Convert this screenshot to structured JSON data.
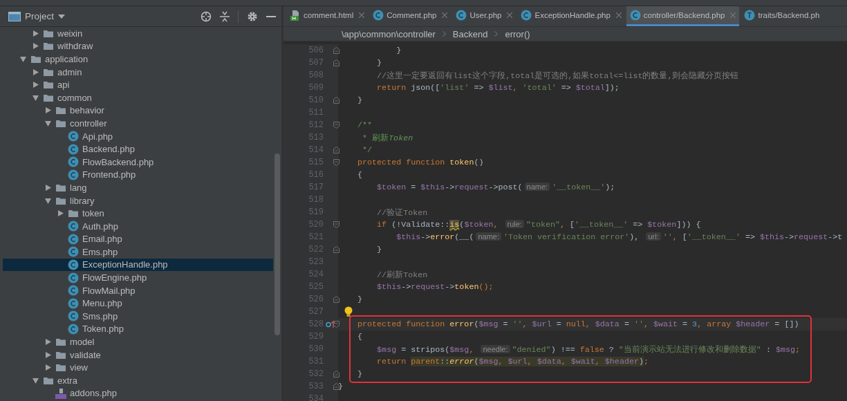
{
  "sidebar": {
    "title": "Project",
    "tree": {
      "cut_parent_children": [
        {
          "label": "weixin",
          "kind": "folder",
          "expanded": false,
          "selected": false
        },
        {
          "label": "withdraw",
          "kind": "folder",
          "expanded": false,
          "selected": false
        }
      ],
      "items": [
        {
          "label": "application",
          "kind": "folder",
          "expanded": true,
          "selected": false,
          "children": [
            {
              "label": "admin",
              "kind": "folder",
              "expanded": false,
              "selected": false
            },
            {
              "label": "api",
              "kind": "folder",
              "expanded": false,
              "selected": false
            },
            {
              "label": "common",
              "kind": "folder",
              "expanded": true,
              "selected": false,
              "children": [
                {
                  "label": "behavior",
                  "kind": "folder",
                  "expanded": false,
                  "selected": false
                },
                {
                  "label": "controller",
                  "kind": "folder",
                  "expanded": true,
                  "selected": false,
                  "children": [
                    {
                      "label": "Api.php",
                      "kind": "class",
                      "selected": false
                    },
                    {
                      "label": "Backend.php",
                      "kind": "class",
                      "selected": false
                    },
                    {
                      "label": "FlowBackend.php",
                      "kind": "class",
                      "selected": false
                    },
                    {
                      "label": "Frontend.php",
                      "kind": "class",
                      "selected": false
                    }
                  ]
                },
                {
                  "label": "lang",
                  "kind": "folder",
                  "expanded": false,
                  "selected": false
                },
                {
                  "label": "library",
                  "kind": "folder",
                  "expanded": true,
                  "selected": false,
                  "children": [
                    {
                      "label": "token",
                      "kind": "folder",
                      "expanded": false,
                      "selected": false
                    },
                    {
                      "label": "Auth.php",
                      "kind": "class",
                      "selected": false
                    },
                    {
                      "label": "Email.php",
                      "kind": "class",
                      "selected": false
                    },
                    {
                      "label": "Ems.php",
                      "kind": "class",
                      "selected": false
                    },
                    {
                      "label": "ExceptionHandle.php",
                      "kind": "class",
                      "selected": true
                    },
                    {
                      "label": "FlowEngine.php",
                      "kind": "class",
                      "selected": false
                    },
                    {
                      "label": "FlowMail.php",
                      "kind": "class",
                      "selected": false
                    },
                    {
                      "label": "Menu.php",
                      "kind": "class",
                      "selected": false
                    },
                    {
                      "label": "Sms.php",
                      "kind": "class",
                      "selected": false
                    },
                    {
                      "label": "Token.php",
                      "kind": "class",
                      "selected": false
                    }
                  ]
                },
                {
                  "label": "model",
                  "kind": "folder",
                  "expanded": false,
                  "selected": false
                },
                {
                  "label": "validate",
                  "kind": "folder",
                  "expanded": false,
                  "selected": false
                },
                {
                  "label": "view",
                  "kind": "folder",
                  "expanded": false,
                  "selected": false
                }
              ]
            },
            {
              "label": "extra",
              "kind": "folder",
              "expanded": true,
              "selected": false,
              "children": [
                {
                  "label": "addons.php",
                  "kind": "php",
                  "selected": false
                }
              ]
            }
          ]
        }
      ]
    }
  },
  "tabs": [
    {
      "label": "comment.html",
      "kind": "html",
      "selected": false,
      "closable": true
    },
    {
      "label": "Comment.php",
      "kind": "class",
      "selected": false,
      "closable": true
    },
    {
      "label": "User.php",
      "kind": "class",
      "selected": false,
      "closable": true
    },
    {
      "label": "ExceptionHandle.php",
      "kind": "class",
      "selected": false,
      "closable": true
    },
    {
      "label": "controller/Backend.php",
      "kind": "class",
      "selected": true,
      "closable": true
    },
    {
      "label": "traits/Backend.ph",
      "kind": "trait",
      "selected": false,
      "closable": false
    }
  ],
  "breadcrumb": [
    "\\app\\common\\controller",
    "Backend",
    "error()"
  ],
  "editor": {
    "lines": [
      {
        "number": "506",
        "fold_close": true,
        "tokens": [
          {
            "kind": "plain",
            "text": "            }"
          }
        ]
      },
      {
        "number": "507",
        "fold_close": true,
        "tokens": [
          {
            "kind": "plain",
            "text": "        }"
          }
        ]
      },
      {
        "number": "508",
        "tokens": [
          {
            "kind": "comment",
            "text": "        //这里一定要返回有list这个字段,total是可选的,如果total<=list的数量,则会隐藏分页按钮"
          }
        ]
      },
      {
        "number": "509",
        "tokens": [
          {
            "kind": "keyword",
            "text": "        return"
          },
          {
            "kind": "plain",
            "text": " json(["
          },
          {
            "kind": "string",
            "text": "'list'"
          },
          {
            "kind": "plain",
            "text": " => "
          },
          {
            "kind": "variable",
            "text": "$list"
          },
          {
            "kind": "keyword",
            "text": ", "
          },
          {
            "kind": "string",
            "text": "'total'"
          },
          {
            "kind": "plain",
            "text": " => "
          },
          {
            "kind": "variable",
            "text": "$total"
          },
          {
            "kind": "plain",
            "text": "]);"
          }
        ]
      },
      {
        "number": "510",
        "fold_close": true,
        "tokens": [
          {
            "kind": "plain",
            "text": "    }"
          }
        ]
      },
      {
        "number": "511"
      },
      {
        "number": "512",
        "fold_open": true,
        "tokens": [
          {
            "kind": "doc",
            "text": "    /**"
          }
        ]
      },
      {
        "number": "513",
        "tokens": [
          {
            "kind": "doc",
            "text": "     * 刷新"
          },
          {
            "kind": "doc_italic",
            "text": "Token"
          }
        ]
      },
      {
        "number": "514",
        "fold_close": true,
        "tokens": [
          {
            "kind": "doc",
            "text": "     */"
          }
        ]
      },
      {
        "number": "515",
        "fold_open": true,
        "tokens": [
          {
            "kind": "keyword",
            "text": "    protected function "
          },
          {
            "kind": "function",
            "text": "token"
          },
          {
            "kind": "plain",
            "text": "()"
          }
        ]
      },
      {
        "number": "516",
        "tokens": [
          {
            "kind": "plain",
            "text": "    {"
          }
        ]
      },
      {
        "number": "517",
        "tokens": [
          {
            "kind": "variable",
            "text": "        $token"
          },
          {
            "kind": "plain",
            "text": " = "
          },
          {
            "kind": "variable",
            "text": "$this"
          },
          {
            "kind": "plain",
            "text": "->"
          },
          {
            "kind": "field",
            "text": "request"
          },
          {
            "kind": "plain",
            "text": "->post("
          },
          {
            "kind": "hint",
            "text": "name:"
          },
          {
            "kind": "string",
            "text": "'__token__'"
          },
          {
            "kind": "plain",
            "text": ");"
          }
        ]
      },
      {
        "number": "518"
      },
      {
        "number": "519",
        "tokens": [
          {
            "kind": "comment",
            "text": "        //验证Token"
          }
        ]
      },
      {
        "number": "520",
        "fold_open": true,
        "tokens": [
          {
            "kind": "keyword",
            "text": "        if"
          },
          {
            "kind": "plain",
            "text": " (!Validate::"
          },
          {
            "kind": "warning",
            "text": "is"
          },
          {
            "kind": "plain",
            "text": "("
          },
          {
            "kind": "variable",
            "text": "$token"
          },
          {
            "kind": "keyword",
            "text": ", "
          },
          {
            "kind": "hint",
            "text": "rule:"
          },
          {
            "kind": "string",
            "text": "\"token\""
          },
          {
            "kind": "keyword",
            "text": ", "
          },
          {
            "kind": "plain",
            "text": "["
          },
          {
            "kind": "string",
            "text": "'__token__'"
          },
          {
            "kind": "plain",
            "text": " => "
          },
          {
            "kind": "variable",
            "text": "$token"
          },
          {
            "kind": "plain",
            "text": "])) {"
          }
        ]
      },
      {
        "number": "521",
        "tokens": [
          {
            "kind": "variable",
            "text": "            $this"
          },
          {
            "kind": "plain",
            "text": "->"
          },
          {
            "kind": "call",
            "text": "error"
          },
          {
            "kind": "plain",
            "text": "(__("
          },
          {
            "kind": "hint",
            "text": "name:"
          },
          {
            "kind": "string",
            "text": "'Token verification error'"
          },
          {
            "kind": "plain",
            "text": "), "
          },
          {
            "kind": "hint",
            "text": "url:"
          },
          {
            "kind": "string",
            "text": "''"
          },
          {
            "kind": "keyword",
            "text": ", "
          },
          {
            "kind": "plain",
            "text": "["
          },
          {
            "kind": "string",
            "text": "'__token__'"
          },
          {
            "kind": "plain",
            "text": " => "
          },
          {
            "kind": "variable",
            "text": "$this"
          },
          {
            "kind": "plain",
            "text": "->"
          },
          {
            "kind": "field",
            "text": "request"
          },
          {
            "kind": "plain",
            "text": "->t"
          }
        ]
      },
      {
        "number": "522",
        "fold_close": true,
        "tokens": [
          {
            "kind": "plain",
            "text": "        }"
          }
        ]
      },
      {
        "number": "523"
      },
      {
        "number": "524",
        "tokens": [
          {
            "kind": "comment",
            "text": "        //刷新Token"
          }
        ]
      },
      {
        "number": "525",
        "tokens": [
          {
            "kind": "variable",
            "text": "        $this"
          },
          {
            "kind": "plain",
            "text": "->"
          },
          {
            "kind": "field",
            "text": "request"
          },
          {
            "kind": "plain",
            "text": "->"
          },
          {
            "kind": "call",
            "text": "token"
          },
          {
            "kind": "keyword",
            "text": "();"
          }
        ]
      },
      {
        "number": "526",
        "fold_close": true,
        "tokens": [
          {
            "kind": "plain",
            "text": "    }"
          }
        ]
      },
      {
        "number": "527",
        "bulb": true
      },
      {
        "number": "528",
        "fold_open": true,
        "current": true,
        "boxed": true,
        "override": true,
        "tokens": [
          {
            "kind": "keyword",
            "text": "    protected function "
          },
          {
            "kind": "function",
            "text": "error"
          },
          {
            "kind": "plain",
            "text": "("
          },
          {
            "kind": "variable",
            "text": "$msg"
          },
          {
            "kind": "plain",
            "text": " = "
          },
          {
            "kind": "string",
            "text": "''"
          },
          {
            "kind": "keyword",
            "text": ", "
          },
          {
            "kind": "variable",
            "text": "$url"
          },
          {
            "kind": "plain",
            "text": " = "
          },
          {
            "kind": "keyword",
            "text": "null, "
          },
          {
            "kind": "variable",
            "text": "$data"
          },
          {
            "kind": "plain",
            "text": " = "
          },
          {
            "kind": "string",
            "text": "''"
          },
          {
            "kind": "keyword",
            "text": ", "
          },
          {
            "kind": "variable",
            "text": "$wait"
          },
          {
            "kind": "plain",
            "text": " = "
          },
          {
            "kind": "number",
            "text": "3"
          },
          {
            "kind": "keyword",
            "text": ", array "
          },
          {
            "kind": "variable",
            "text": "$header"
          },
          {
            "kind": "plain",
            "text": " = [])"
          }
        ]
      },
      {
        "number": "529",
        "boxed": true,
        "tokens": [
          {
            "kind": "plain",
            "text": "    {"
          }
        ]
      },
      {
        "number": "530",
        "boxed": true,
        "tokens": [
          {
            "kind": "variable",
            "text": "        $msg"
          },
          {
            "kind": "plain",
            "text": " = stripos("
          },
          {
            "kind": "variable",
            "text": "$msg"
          },
          {
            "kind": "keyword",
            "text": ", "
          },
          {
            "kind": "hint",
            "text": "needle:"
          },
          {
            "kind": "string",
            "text": "\"denied\""
          },
          {
            "kind": "plain",
            "text": ") !== "
          },
          {
            "kind": "keyword",
            "text": "false"
          },
          {
            "kind": "plain",
            "text": " ? "
          },
          {
            "kind": "string",
            "text": "\"当前演示站无法进行修改和删除数据\""
          },
          {
            "kind": "plain",
            "text": " : "
          },
          {
            "kind": "variable",
            "text": "$msg"
          },
          {
            "kind": "keyword",
            "text": ";"
          }
        ]
      },
      {
        "number": "531",
        "boxed": true,
        "tokens": [
          {
            "kind": "keyword",
            "text": "        return "
          },
          {
            "kind": "keyword_marked",
            "text": "parent"
          },
          {
            "kind": "plain_marked",
            "text": "::"
          },
          {
            "kind": "function_marked",
            "text": "error"
          },
          {
            "kind": "plain_marked",
            "text": "("
          },
          {
            "kind": "variable_marked",
            "text": "$msg"
          },
          {
            "kind": "keyword_marked",
            "text": ", "
          },
          {
            "kind": "variable_marked",
            "text": "$url"
          },
          {
            "kind": "keyword_marked",
            "text": ", "
          },
          {
            "kind": "variable_marked",
            "text": "$data"
          },
          {
            "kind": "keyword_marked",
            "text": ", "
          },
          {
            "kind": "variable_marked",
            "text": "$wait"
          },
          {
            "kind": "keyword_marked",
            "text": ", "
          },
          {
            "kind": "variable_marked",
            "text": "$header"
          },
          {
            "kind": "plain_marked",
            "text": ")"
          },
          {
            "kind": "keyword",
            "text": ";"
          }
        ]
      },
      {
        "number": "532",
        "fold_close": true,
        "boxed": true,
        "tokens": [
          {
            "kind": "plain",
            "text": "    }"
          }
        ]
      },
      {
        "number": "533",
        "fold_close": true,
        "tokens": [
          {
            "kind": "plain",
            "text": "}"
          }
        ]
      },
      {
        "number": "534"
      }
    ]
  }
}
